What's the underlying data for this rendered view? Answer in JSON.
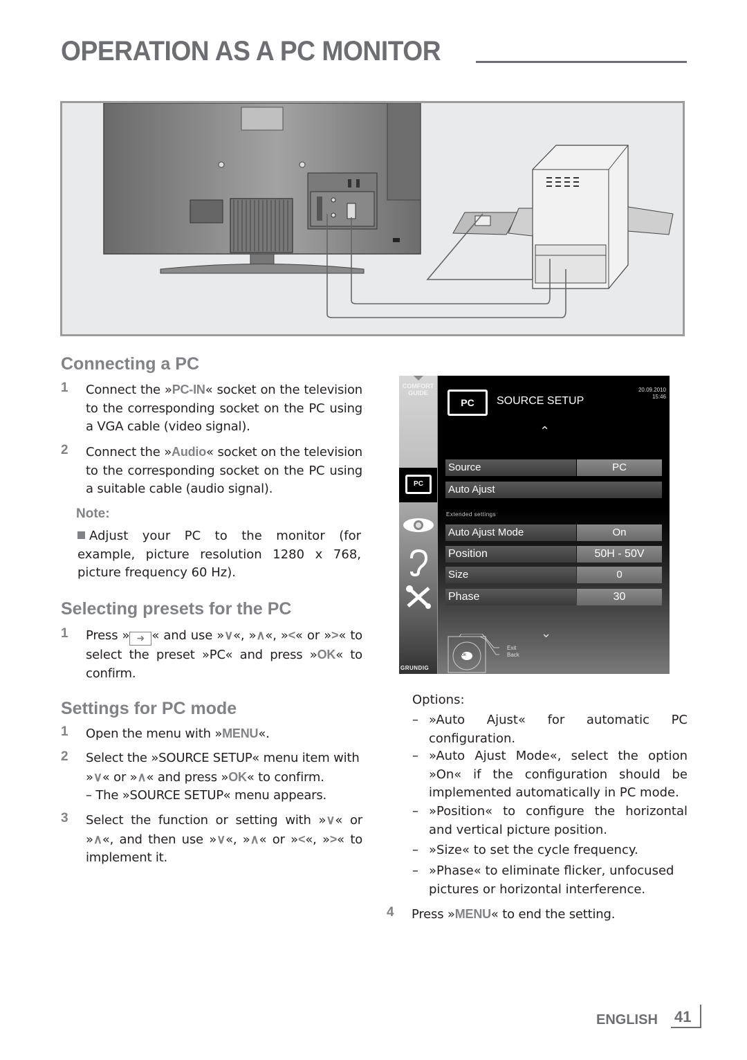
{
  "page": {
    "title": "OPERATION AS A PC MONITOR",
    "footer_language": "ENGLISH",
    "page_number": "41"
  },
  "connecting": {
    "heading": "Connecting a PC",
    "steps": [
      {
        "num": "1",
        "pre": "Connect the »",
        "hl": "PC-IN",
        "post": "« socket on the television to the corresponding socket on the PC using a VGA cable (video signal)."
      },
      {
        "num": "2",
        "pre": "Connect the »",
        "hl": "Audio",
        "post": "« socket on the television to the corresponding socket on the PC using a suitable cable (audio signal)."
      }
    ],
    "note_label": "Note:",
    "note_text": "Adjust your PC to the monitor (for example, picture resolution 1280 x 768, picture frequency 60 Hz)."
  },
  "presets": {
    "heading": "Selecting presets for the PC",
    "step_num": "1",
    "parts": [
      "Press »",
      "« and use »",
      "«, »",
      "«, »",
      "« or »",
      "« to select the preset »PC« and press »",
      "OK",
      "« to confirm."
    ]
  },
  "settings": {
    "heading": "Settings for PC mode",
    "step1": {
      "num": "1",
      "pre": "Open the menu with »",
      "hl": "MENU",
      "post": "«."
    },
    "step2": {
      "num": "2",
      "a": "Select the »SOURCE SETUP« menu item with »",
      "b": "« or »",
      "c": "« and press »",
      "hl": "OK",
      "d": "« to confirm.",
      "sub": "– The »SOURCE SETUP« menu appears."
    },
    "step3": {
      "num": "3",
      "a": "Select the function or setting with »",
      "b": "« or »",
      "c": "«, and then use »",
      "d": "«, »",
      "e": "« or »",
      "f": "«, »",
      "g": "« to implement it."
    },
    "options_label": "Options:",
    "options": [
      "»Auto Ajust« for automatic PC configuration.",
      "»Auto Ajust Mode«, select the option »On« if the configuration should be implemented automatically in PC mode.",
      "»Position« to configure the horizontal and vertical picture position.",
      "»Size« to set the cycle frequency.",
      "»Phase« to eliminate flicker, unfocused pictures or horizontal interference."
    ],
    "step4": {
      "num": "4",
      "pre": "Press »",
      "hl": "MENU",
      "post": "« to end the setting."
    }
  },
  "tv_menu": {
    "comfort_guide": [
      "COMFORT",
      "GUIDE"
    ],
    "title": "SOURCE SETUP",
    "icon_label": "PC",
    "date": "20.09.2010",
    "time": "15:46",
    "rows": [
      {
        "label": "Source",
        "value": "PC"
      },
      {
        "label": "Auto Ajust",
        "value": ""
      }
    ],
    "extended_label": "Extended settings",
    "extended_rows": [
      {
        "label": "Auto Ajust Mode",
        "value": "On"
      },
      {
        "label": "Position",
        "value": "50H - 50V"
      },
      {
        "label": "Size",
        "value": "0"
      },
      {
        "label": "Phase",
        "value": "30"
      }
    ],
    "nav_ok": "OK",
    "legend_exit": "Exit",
    "legend_back": "Back",
    "brand": "GRUNDIG"
  },
  "illustration": {
    "description": "Rear view of television connected to PC tower with VGA and audio cables"
  }
}
